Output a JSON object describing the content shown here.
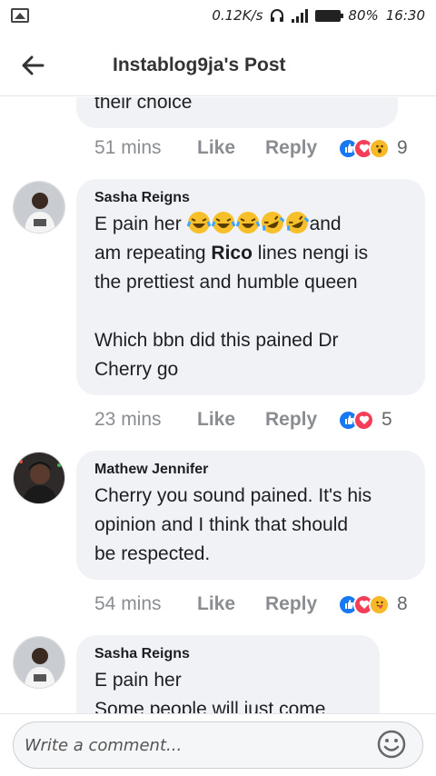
{
  "status": {
    "speed": "0.12K/s",
    "battery": "80%",
    "time": "16:30"
  },
  "header": {
    "title": "Instablog9ja's Post"
  },
  "comments": [
    {
      "text_tail": "their choice",
      "time": "51 mins",
      "like": "Like",
      "reply": "Reply",
      "reactions": [
        "like",
        "love",
        "wow"
      ],
      "count": "9"
    },
    {
      "author": "Sasha Reigns",
      "line1_pre": "E pain her",
      "line1_post": "and",
      "line2_pre": "am repeating",
      "line2_bold": "Rico",
      "line2_post": " lines nengi is",
      "line3": "the prettiest and humble queen",
      "line4": "Which bbn did this pained Dr",
      "line5": "Cherry go",
      "time": "23 mins",
      "like": "Like",
      "reply": "Reply",
      "reactions": [
        "like",
        "love"
      ],
      "count": "5"
    },
    {
      "author": "Mathew Jennifer",
      "line1": "Cherry you sound pained. It's his",
      "line2": "opinion and I think that should",
      "line3": "be respected.",
      "time": "54 mins",
      "like": "Like",
      "reply": "Reply",
      "reactions": [
        "like",
        "love",
        "care"
      ],
      "count": "8"
    },
    {
      "author": "Sasha Reigns",
      "line1": "E pain her",
      "line2": "Some people will just come"
    }
  ],
  "composer": {
    "placeholder": "Write a comment..."
  },
  "icons": {
    "back": "arrow-left-icon",
    "emoji": "smiley-icon"
  }
}
